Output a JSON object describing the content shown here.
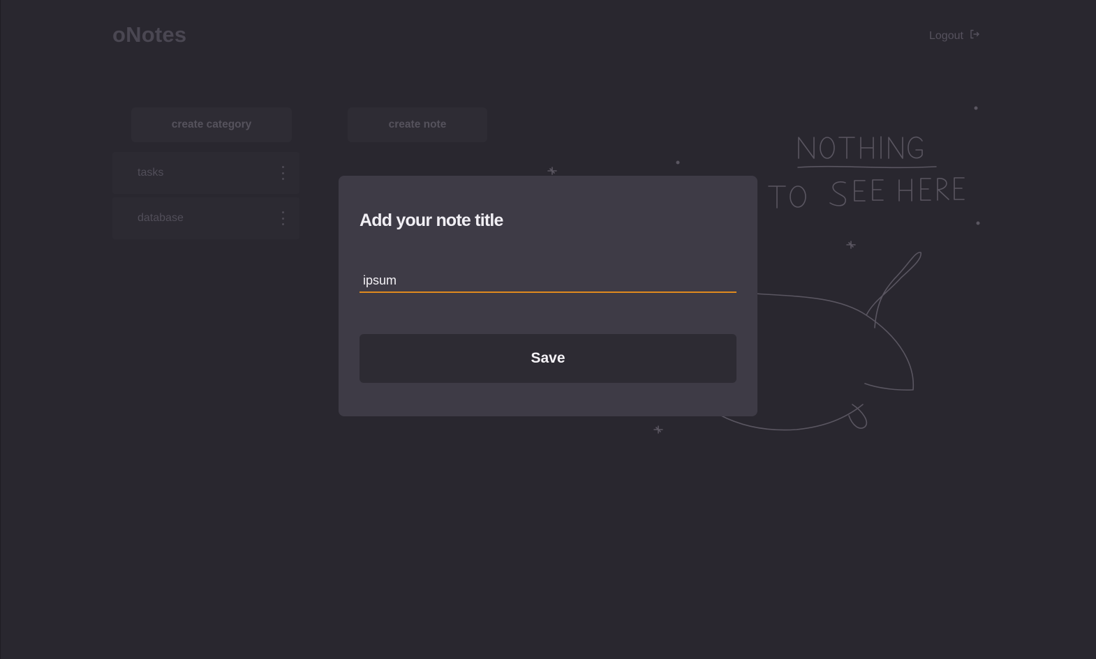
{
  "header": {
    "app_title": "oNotes",
    "logout_label": "Logout",
    "logout_icon": "logout-icon"
  },
  "toolbar": {
    "create_category_label": "create category",
    "create_note_label": "create note"
  },
  "sidebar": {
    "categories": [
      {
        "label": "tasks",
        "menu_icon": "more-vertical-icon"
      },
      {
        "label": "database",
        "menu_icon": "more-vertical-icon"
      }
    ]
  },
  "empty_state": {
    "illustration": "whale-doodle-illustration",
    "line1": "NOTHING",
    "line2": "TO SEE HERE"
  },
  "modal": {
    "title": "Add your note title",
    "input_value": "ipsum",
    "save_label": "Save"
  },
  "colors": {
    "background": "#29272f",
    "modal_background": "#3e3b46",
    "input_accent": "#e08a1e",
    "button_background": "#2d2b33"
  }
}
